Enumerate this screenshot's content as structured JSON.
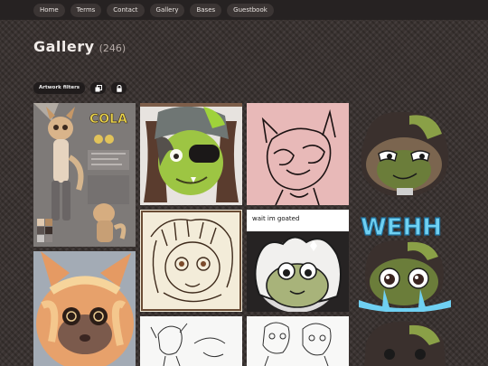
{
  "nav": {
    "items": [
      "Home",
      "Terms",
      "Contact",
      "Gallery",
      "Bases",
      "Guestbook"
    ]
  },
  "page": {
    "title": "Gallery",
    "count": "(246)"
  },
  "toolbar": {
    "filters_label": "Artwork filters",
    "copy_icon": "copy-icon",
    "lock_icon": "lock-icon"
  },
  "gallery": {
    "ref_sheet_text": "COLA",
    "meme_caption": "wait im goated",
    "emote_text": "WEHH"
  },
  "colors": {
    "nav_bg": "#262222",
    "pill_bg": "#3b3534",
    "sketch_pink": "#e7b9b9"
  }
}
